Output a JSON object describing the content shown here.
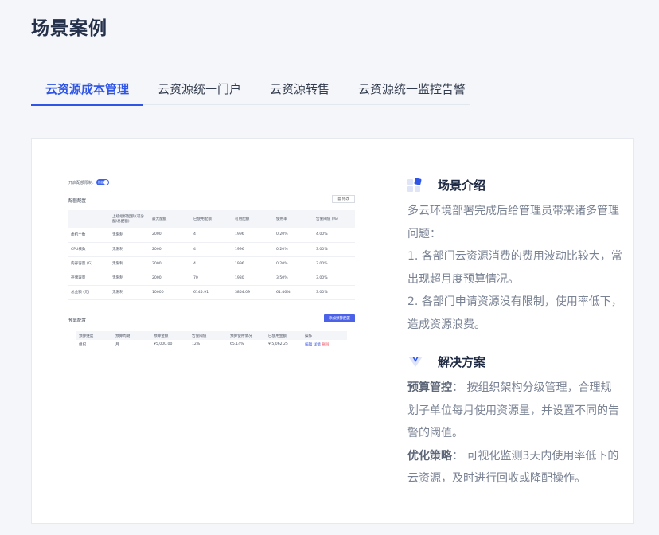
{
  "page_title": "场景案例",
  "tabs": [
    {
      "label": "云资源成本管理",
      "active": true
    },
    {
      "label": "云资源统一门户",
      "active": false
    },
    {
      "label": "云资源转售",
      "active": false
    },
    {
      "label": "云资源统一监控告警",
      "active": false
    }
  ],
  "preview": {
    "toggle_label": "开启配额限制:",
    "toggle_state": "开启",
    "quota_title": "配额配置",
    "edit_label": "修改",
    "quota_headers": [
      "",
      "上级组织配额 (可分配/总配额)",
      "最大配额",
      "已使用配额",
      "可用配额",
      "使用率",
      "告警阈值 (%)"
    ],
    "quota_rows": [
      [
        "虚机个数",
        "无限制",
        "2000",
        "4",
        "1996",
        "0.20%",
        "4.00%"
      ],
      [
        "CPU核数",
        "无限制",
        "2000",
        "4",
        "1996",
        "0.20%",
        "3.00%"
      ],
      [
        "内存容量 (G)",
        "无限制",
        "2000",
        "4",
        "1996",
        "0.20%",
        "3.00%"
      ],
      [
        "存储容量",
        "无限制",
        "2000",
        "70",
        "1930",
        "3.50%",
        "3.00%"
      ],
      [
        "总金额 (元)",
        "无限制",
        "10000",
        "6145.91",
        "3854.09",
        "61.46%",
        "3.00%"
      ]
    ],
    "budget_title": "预算配置",
    "add_budget_label": "添加预算配置",
    "budget_headers": [
      "预算维度",
      "预算周期",
      "预算金额",
      "告警阈值",
      "预算使用情况",
      "已使用金额",
      "操作"
    ],
    "budget_rows": [
      [
        "组织",
        "月",
        "¥5,000.00",
        "12%",
        "65.14%",
        "¥ 5,062.25"
      ]
    ],
    "budget_ops": [
      "编辑",
      "详情",
      "删除"
    ]
  },
  "intro": {
    "title": "场景介绍",
    "paragraphs": [
      "多云环境部署完成后给管理员带来诸多管理问题：",
      "1. 各部门云资源消费的费用波动比较大，常出现超月度预算情况。",
      "2. 各部门申请资源没有限制，使用率低下，造成资源浪费。"
    ]
  },
  "solution": {
    "title": "解决方案",
    "items": [
      {
        "label": "预算管控",
        "text": "： 按组织架构分级管理，合理规划子单位每月使用资源量，并设置不同的告警的阈值。"
      },
      {
        "label": "优化策略",
        "text": "： 可视化监测3天内使用率低下的云资源，及时进行回收或降配操作。"
      }
    ]
  },
  "colors": {
    "accent": "#2f55e6",
    "text_muted": "#7a8394",
    "danger": "#e85b6a"
  }
}
